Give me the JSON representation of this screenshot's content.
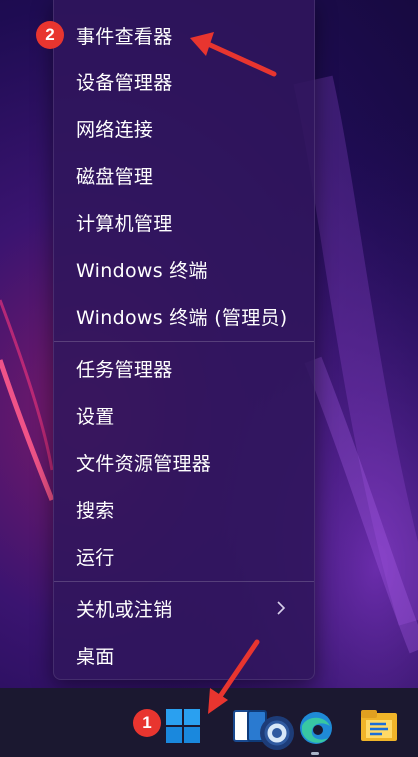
{
  "menu": {
    "items": [
      {
        "label": "事件查看器"
      },
      {
        "label": "设备管理器"
      },
      {
        "label": "网络连接"
      },
      {
        "label": "磁盘管理"
      },
      {
        "label": "计算机管理"
      },
      {
        "label": "Windows 终端"
      },
      {
        "label": "Windows 终端 (管理员)"
      },
      {
        "label": "任务管理器"
      },
      {
        "label": "设置"
      },
      {
        "label": "文件资源管理器"
      },
      {
        "label": "搜索"
      },
      {
        "label": "运行"
      },
      {
        "label": "关机或注销"
      },
      {
        "label": "桌面"
      }
    ]
  },
  "annotations": {
    "badge_1": "1",
    "badge_2": "2",
    "color": "#e8352f"
  },
  "taskbar": {
    "icons": [
      "windows-start-icon",
      "task-view-icon",
      "search-icon",
      "edge-icon",
      "file-explorer-icon"
    ]
  }
}
